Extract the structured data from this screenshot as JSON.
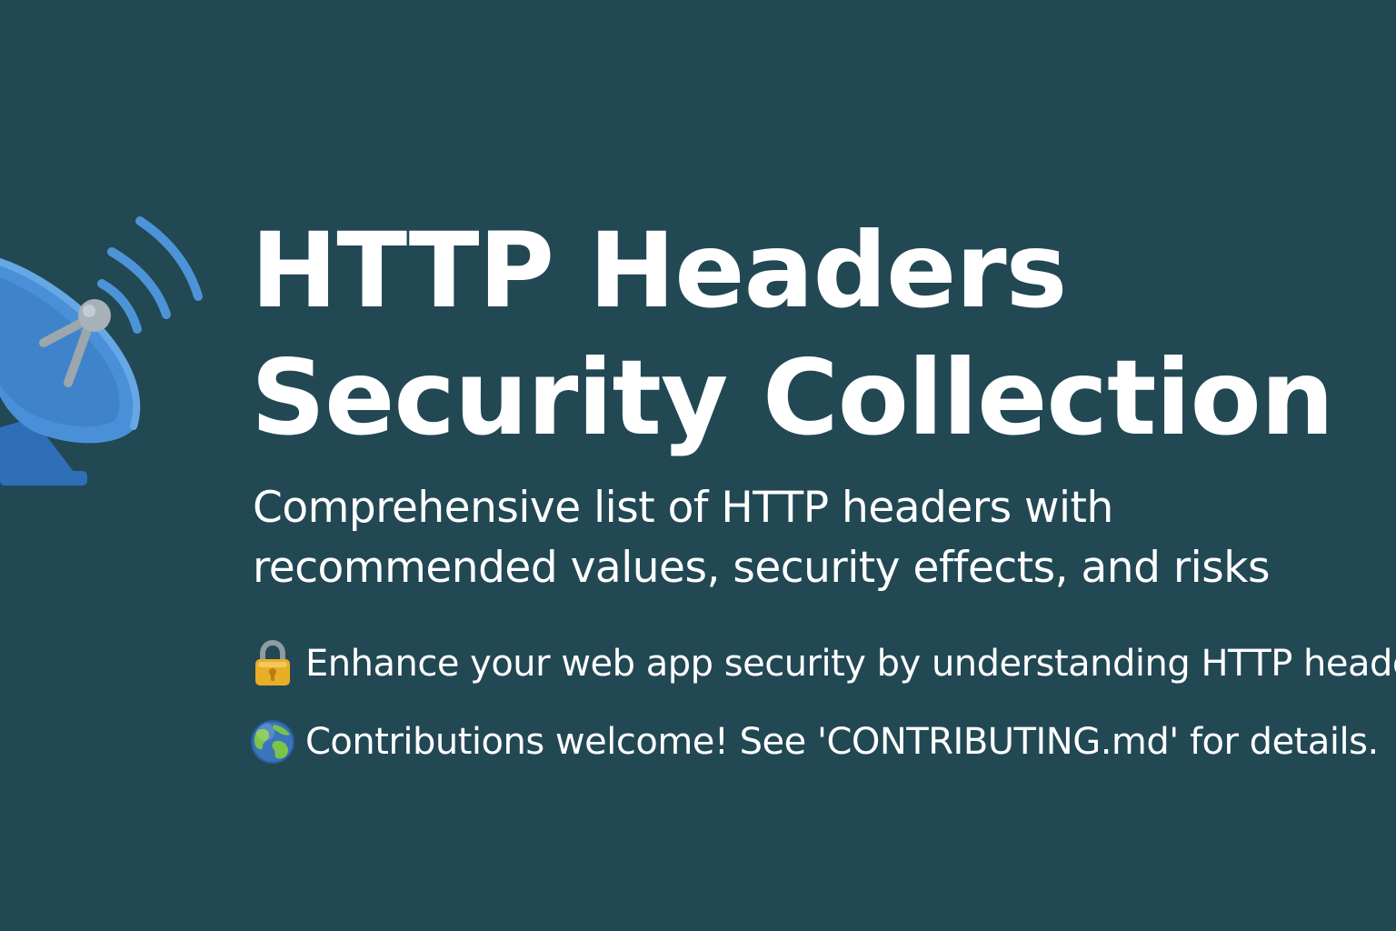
{
  "banner": {
    "title_line_1": "HTTP Headers",
    "title_line_2": "Security Collection",
    "subtitle_line_1": "Comprehensive list of HTTP headers with",
    "subtitle_line_2": "recommended values, security effects, and risks",
    "features": [
      {
        "icon": "lock-icon",
        "text": "Enhance your web app security by understanding HTTP headers"
      },
      {
        "icon": "globe-icon",
        "text": "Contributions welcome! See 'CONTRIBUTING.md' for details."
      }
    ]
  },
  "colors": {
    "background": "#224854",
    "text": "#ffffff",
    "dish_blue": "#4a90d9",
    "dish_dark_blue": "#2f6fb8",
    "signal_blue": "#4c93d8",
    "lock_gold": "#e8ae25",
    "globe_blue": "#3875bd",
    "globe_green": "#7bc447"
  }
}
